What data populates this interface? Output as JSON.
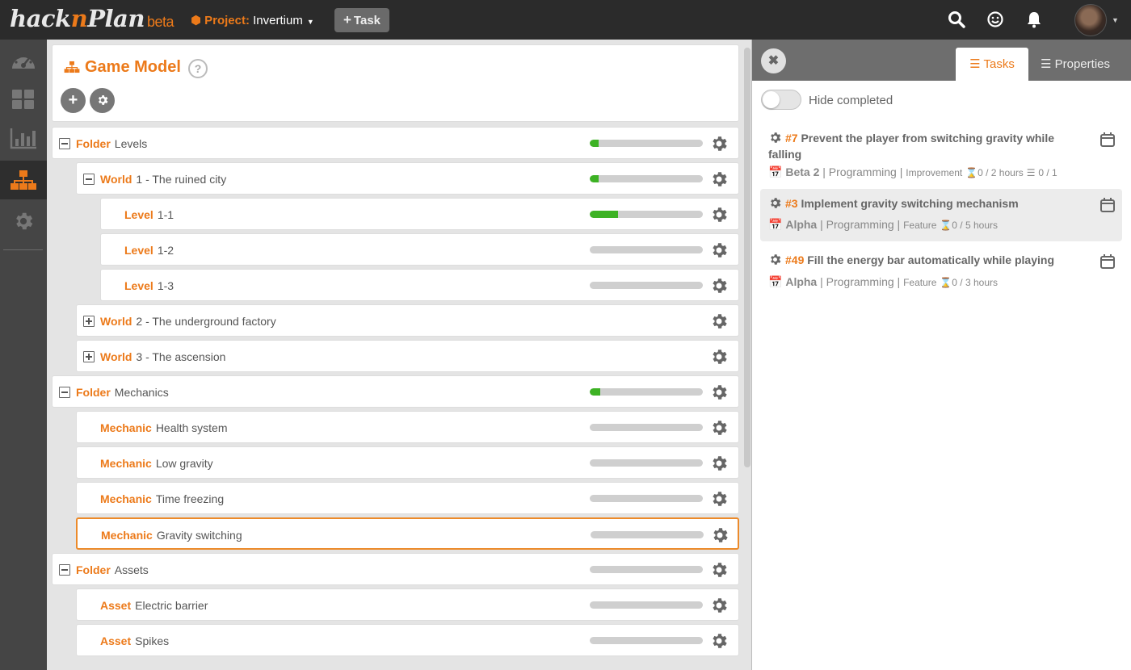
{
  "topbar": {
    "logo": {
      "part1": "hack",
      "part2": "n",
      "part3": "Plan",
      "beta": "beta"
    },
    "project_label": "Project:",
    "project_name": "Invertium",
    "task_button": "Task"
  },
  "sidebar": {
    "items": [
      {
        "icon": "dashboard-icon",
        "active": false
      },
      {
        "icon": "board-icon",
        "active": false
      },
      {
        "icon": "analytics-icon",
        "active": false
      },
      {
        "icon": "game-model-icon",
        "active": true
      },
      {
        "icon": "settings-icon",
        "active": false
      }
    ]
  },
  "game_model": {
    "title": "Game Model",
    "help": "?"
  },
  "tree": {
    "rows": [
      {
        "kind": "Folder",
        "name": "Levels",
        "progress": 0.08
      },
      {
        "kind": "World",
        "name": "1 - The ruined city",
        "progress": 0.08
      },
      {
        "kind": "Level",
        "name": "1-1",
        "progress": 0.25
      },
      {
        "kind": "Level",
        "name": "1-2",
        "progress": 0
      },
      {
        "kind": "Level",
        "name": "1-3",
        "progress": 0
      },
      {
        "kind": "World",
        "name": "2 - The underground factory"
      },
      {
        "kind": "World",
        "name": "3 - The ascension"
      },
      {
        "kind": "Folder",
        "name": "Mechanics",
        "progress": 0.09
      },
      {
        "kind": "Mechanic",
        "name": "Health system",
        "progress": 0
      },
      {
        "kind": "Mechanic",
        "name": "Low gravity",
        "progress": 0
      },
      {
        "kind": "Mechanic",
        "name": "Time freezing",
        "progress": 0
      },
      {
        "kind": "Mechanic",
        "name": "Gravity switching",
        "progress": 0,
        "selected": true
      },
      {
        "kind": "Folder",
        "name": "Assets",
        "progress": 0
      },
      {
        "kind": "Asset",
        "name": "Electric barrier",
        "progress": 0
      },
      {
        "kind": "Asset",
        "name": "Spikes",
        "progress": 0
      }
    ]
  },
  "right_panel": {
    "tabs": {
      "tasks": "Tasks",
      "properties": "Properties"
    },
    "hide_completed": "Hide completed",
    "tasks": [
      {
        "id": "#7",
        "title": "Prevent the player from switching gravity while falling",
        "milestone": "Beta 2",
        "category": "Programming",
        "type": "Improvement",
        "hours": "0 / 2 hours",
        "subtasks": "0 / 1"
      },
      {
        "id": "#3",
        "title": "Implement gravity switching mechanism",
        "milestone": "Alpha",
        "category": "Programming",
        "type": "Feature",
        "hours": "0 / 5 hours"
      },
      {
        "id": "#49",
        "title": "Fill the energy bar automatically while playing",
        "milestone": "Alpha",
        "category": "Programming",
        "type": "Feature",
        "hours": "0 / 3 hours"
      }
    ]
  }
}
